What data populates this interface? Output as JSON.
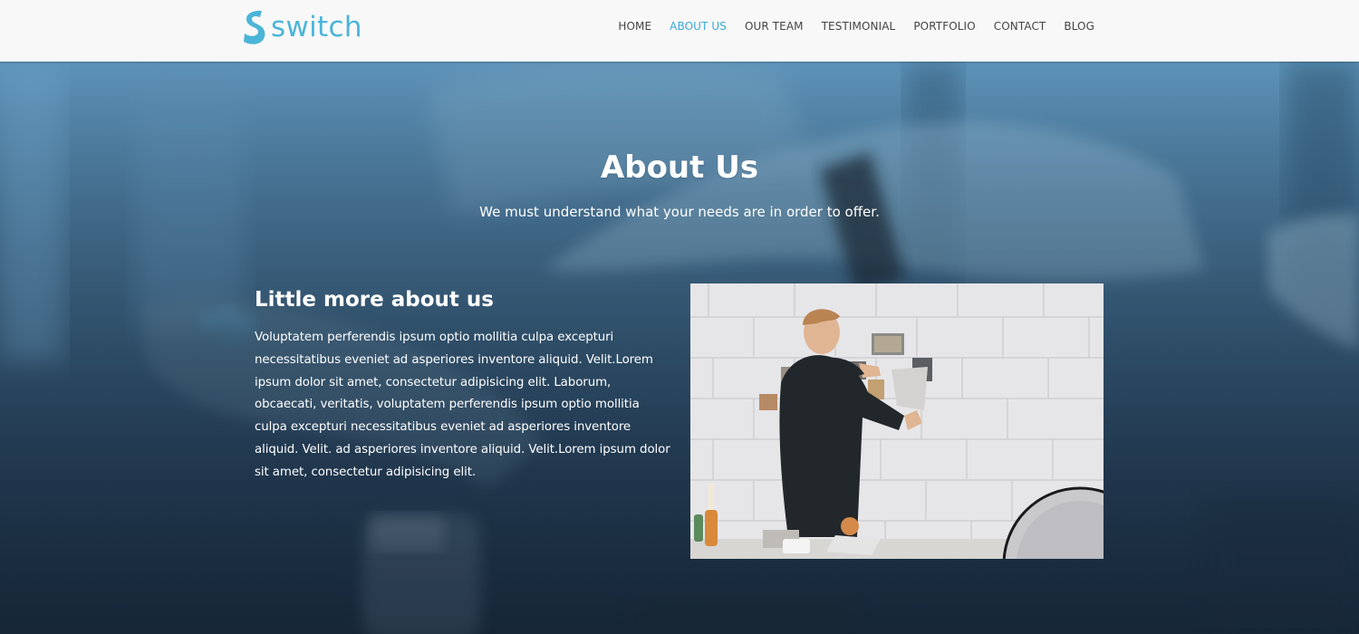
{
  "brand": {
    "name": "switch",
    "color": "#4bb5d8"
  },
  "nav": {
    "items": [
      {
        "label": "HOME",
        "active": false
      },
      {
        "label": "ABOUT US",
        "active": true
      },
      {
        "label": "OUR TEAM",
        "active": false
      },
      {
        "label": "TESTIMONIAL",
        "active": false
      },
      {
        "label": "PORTFOLIO",
        "active": false
      },
      {
        "label": "CONTACT",
        "active": false
      },
      {
        "label": "BLOG",
        "active": false
      }
    ],
    "active_color": "#3aa8d8"
  },
  "hero": {
    "title": "About Us",
    "subtitle": "We must understand what your needs are in order to offer."
  },
  "about": {
    "heading": "Little more about us",
    "body": "Voluptatem perferendis ipsum optio mollitia culpa excepturi necessitatibus eveniet ad asperiores inventore aliquid. Velit.Lorem ipsum dolor sit amet, consectetur adipisicing elit. Laborum, obcaecati, veritatis, voluptatem perferendis ipsum optio mollitia culpa excepturi necessitatibus eveniet ad asperiores inventore aliquid. Velit. ad asperiores inventore aliquid. Velit.Lorem ipsum dolor sit amet, consectetur adipisicing elit."
  },
  "icons": {
    "logo": "switch-s-logo-icon"
  }
}
